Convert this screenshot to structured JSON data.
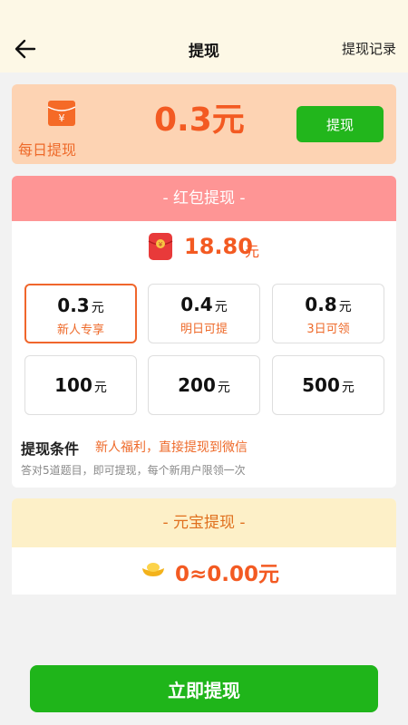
{
  "topbar": {
    "title": "提现",
    "record_link": "提现记录"
  },
  "daily": {
    "label": "每日提现",
    "amount": "0.3元",
    "button": "提现"
  },
  "red_packet": {
    "header": "- 红包提现 -",
    "balance": "18.80",
    "balance_unit": "元",
    "options": [
      {
        "amount": "0.3",
        "unit": "元",
        "tag": "新人专享",
        "selected": true
      },
      {
        "amount": "0.4",
        "unit": "元",
        "tag": "明日可提"
      },
      {
        "amount": "0.8",
        "unit": "元",
        "tag": "3日可领"
      },
      {
        "amount": "100",
        "unit": "元"
      },
      {
        "amount": "200",
        "unit": "元"
      },
      {
        "amount": "500",
        "unit": "元"
      }
    ],
    "condition_title": "提现条件",
    "condition_text": "新人福利，直接提现到微信",
    "condition_note": "答对5道题目，即可提现，每个新用户限领一次"
  },
  "yuanbao": {
    "header": "- 元宝提现 -",
    "value": "0≈0.00元"
  },
  "main_button": "立即提现",
  "icons": {
    "back": "arrow-left-icon",
    "daily": "red-envelope-icon",
    "balance": "red-packet-icon",
    "yuanbao": "gold-ingot-icon"
  },
  "colors": {
    "accent": "#f35a22",
    "green": "#1fb51a",
    "pink_header": "#fe9595",
    "peach_card": "#fdd3b3"
  }
}
